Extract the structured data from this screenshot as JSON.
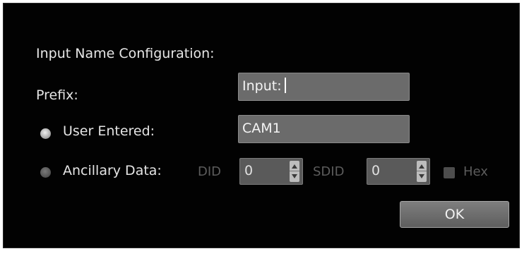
{
  "dialog": {
    "title": "Input Name Configuration:",
    "prefix": {
      "label": "Prefix:",
      "value": "Input:"
    },
    "user_entered": {
      "label": "User Entered:",
      "value": "CAM1",
      "selected": true
    },
    "ancillary_data": {
      "label": "Ancillary Data:",
      "selected": false,
      "did_label": "DID",
      "did_value": "0",
      "sdid_label": "SDID",
      "sdid_value": "0",
      "hex_label": "Hex",
      "hex_checked": false
    },
    "ok_label": "OK"
  },
  "colors": {
    "background": "#020202",
    "field": "#6b6b6b",
    "disabled_text": "#5c5c5c"
  }
}
